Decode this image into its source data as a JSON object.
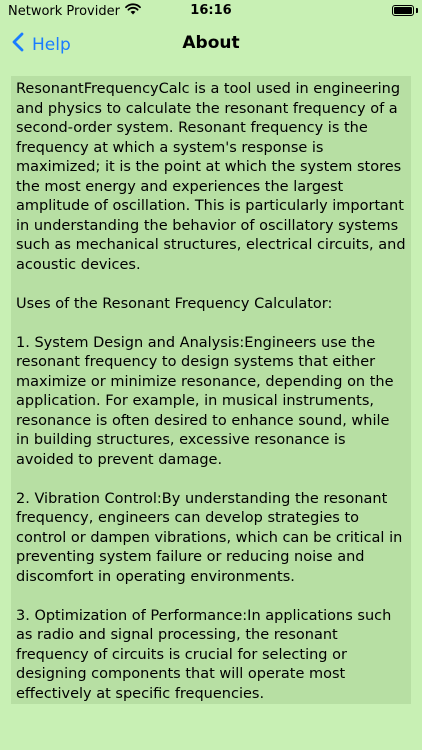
{
  "status_bar": {
    "carrier": "Network Provider",
    "time": "16:16",
    "wifi_icon": "wifi-icon",
    "battery_icon": "battery-icon"
  },
  "nav": {
    "back_label": "Help",
    "back_icon": "chevron-left-icon",
    "title": "About"
  },
  "content": {
    "text": "ResonantFrequencyCalc is a tool used in engineering and physics to calculate the resonant frequency of a second-order system. Resonant frequency is the frequency at which a system's response is maximized; it is the point at which the system stores the most energy and experiences the largest amplitude of oscillation. This is particularly important in understanding the behavior of oscillatory systems such as mechanical structures, electrical circuits, and acoustic devices.\n\nUses of the Resonant Frequency Calculator:\n\n1. System Design and Analysis:Engineers use the resonant frequency to design systems that either maximize or minimize resonance, depending on the application. For example, in musical instruments, resonance is often desired to enhance sound, while in building structures, excessive resonance is avoided to prevent damage.\n\n2. Vibration Control:By understanding the resonant frequency, engineers can develop strategies to control or dampen vibrations, which can be critical in preventing system failure or reducing noise and discomfort in operating environments.\n\n3. Optimization of Performance:In applications such as radio and signal processing, the resonant frequency of circuits is crucial for selecting or designing components that will operate most effectively at specific frequencies."
  },
  "colors": {
    "background": "#c8f0b4",
    "content_background": "#b7dfa3",
    "accent": "#1a7cff"
  }
}
